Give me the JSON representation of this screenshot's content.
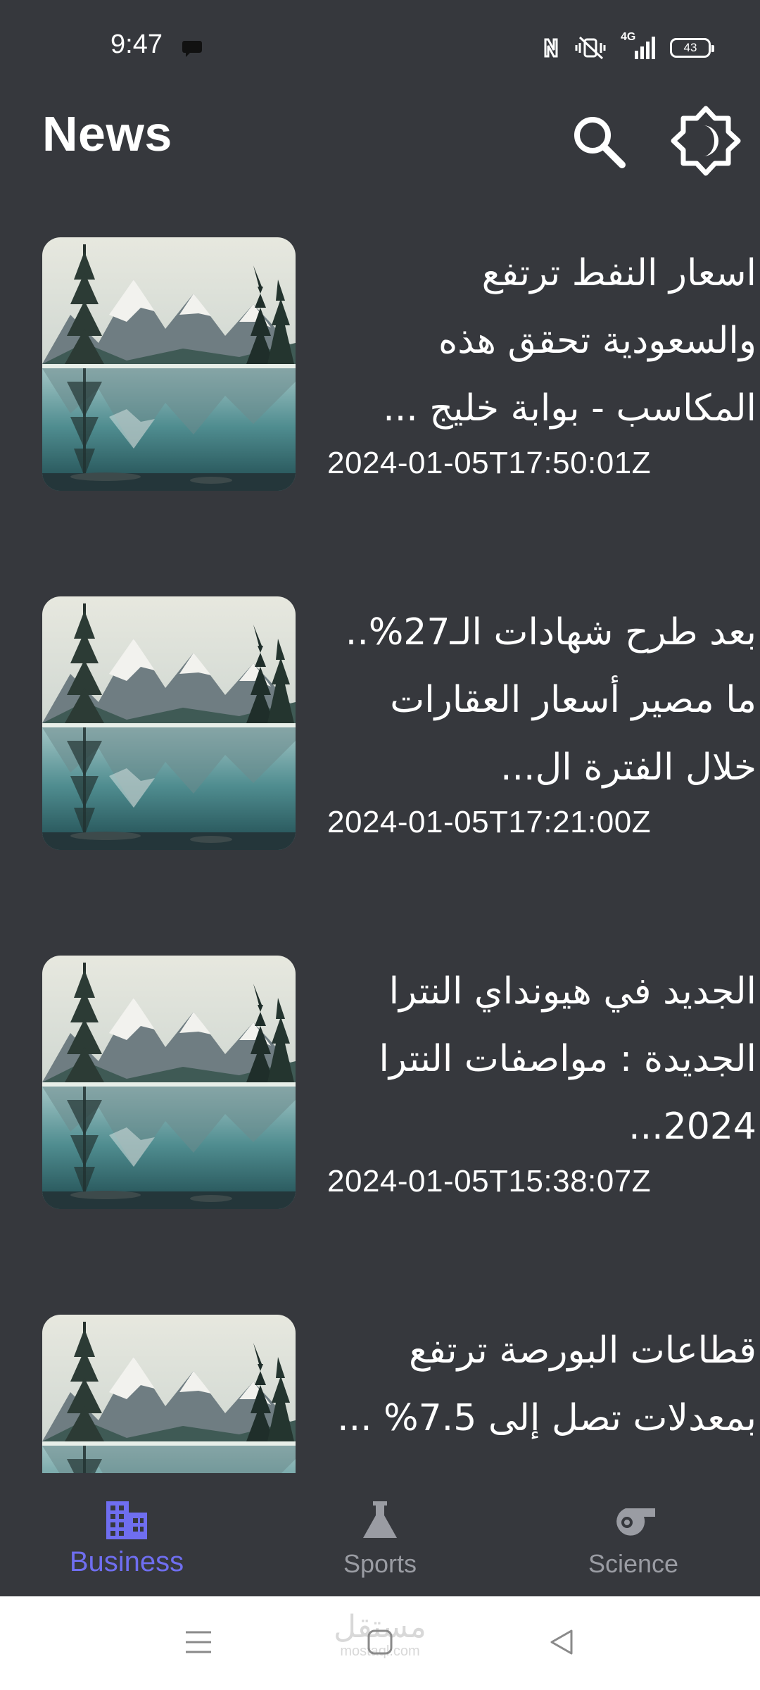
{
  "status_bar": {
    "time": "9:47",
    "network": "4G",
    "battery": "43",
    "icons": [
      "chat-bubble-icon",
      "nfc-icon",
      "vibrate-icon",
      "signal-icon",
      "battery-icon"
    ]
  },
  "header": {
    "title": "News",
    "icons": [
      "search-icon",
      "theme-toggle-icon"
    ]
  },
  "articles": [
    {
      "title": "اسعار النفط ترتفع والسعودية تحقق هذه المكاسب - بوابة خليج ...",
      "date": "2024-01-05T17:50:01Z"
    },
    {
      "title": "بعد طرح شهادات الـ27%.. ما مصير أسعار العقارات خلال الفترة ال...",
      "date": "2024-01-05T17:21:00Z"
    },
    {
      "title": "الجديد في هيونداي النترا الجديدة : مواصفات النترا 2024...",
      "date": "2024-01-05T15:38:07Z"
    },
    {
      "title": "قطاعات البورصة ترتفع بمعدلات تصل إلى 7.5% ...",
      "date": ""
    }
  ],
  "bottom_nav": {
    "items": [
      {
        "label": "Business",
        "icon": "business-building-icon",
        "active": true
      },
      {
        "label": "Sports",
        "icon": "sports-flask-icon",
        "active": false
      },
      {
        "label": "Science",
        "icon": "science-whistle-icon",
        "active": false
      }
    ]
  },
  "system_nav": {
    "watermark": "مستقل",
    "watermark_sub": "mostaql.com",
    "icons": [
      "menu-icon",
      "home-icon",
      "back-icon"
    ]
  },
  "colors": {
    "background": "#36383d",
    "accent": "#6f6ef0",
    "inactive": "#9a9ca3",
    "system_bar": "#ffffff"
  }
}
